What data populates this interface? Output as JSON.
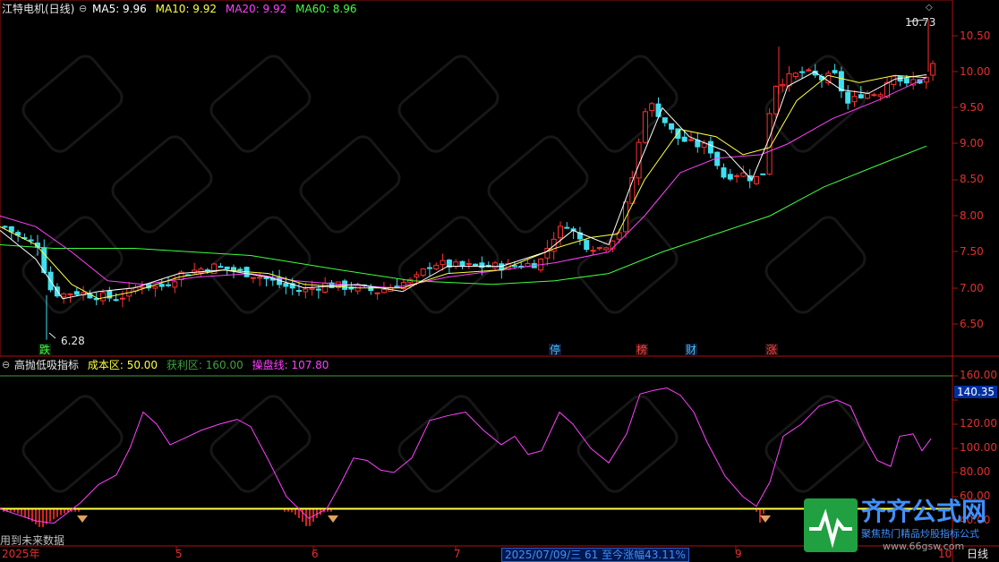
{
  "main": {
    "title": "江特电机(日线)",
    "ma_labels": [
      {
        "text": "MA5: 9.96",
        "color": "#ffffff"
      },
      {
        "text": "MA10: 9.92",
        "color": "#ffff40"
      },
      {
        "text": "MA20: 9.92",
        "color": "#ff40ff"
      },
      {
        "text": "MA60: 8.96",
        "color": "#40ff40"
      }
    ],
    "price_axis": [
      "10.50",
      "10.00",
      "9.50",
      "9.00",
      "8.50",
      "8.00",
      "7.50",
      "7.00",
      "6.50"
    ],
    "high_label": "10.73",
    "low_label": "6.28",
    "event_tags": [
      {
        "text": "跌",
        "color": "#40ff40"
      },
      {
        "text": "停",
        "color": "#40c0ff"
      },
      {
        "text": "榜",
        "color": "#ff4040"
      },
      {
        "text": "财",
        "color": "#40c0ff"
      },
      {
        "text": "涨",
        "color": "#ff4040"
      }
    ]
  },
  "indicator": {
    "name": "高抛低吸指标",
    "cost_zone": "成本区: 50.00",
    "profit_zone": "获利区: 160.00",
    "operate_line": "操盘线: 107.80",
    "axis": [
      "160.00",
      "140.00",
      "120.00",
      "100.00",
      "80.00",
      "60.00",
      "40.00"
    ],
    "current_value": "140.35",
    "note": "用到未来数据"
  },
  "time_axis": {
    "labels": [
      "2025年",
      "5",
      "6",
      "7",
      "9",
      "10"
    ],
    "info": "2025/07/09/三 61 至今涨幅43.11%",
    "period": "日线"
  },
  "watermark": {
    "brand": "齐齐公式网",
    "slogan": "聚焦热门精品炒股指标公式",
    "url": "www.66gsw.com"
  },
  "colors": {
    "up": "#ff3030",
    "down": "#40e0f0",
    "ma5": "#ffffff",
    "ma10": "#ffff40",
    "ma20": "#ff40ff",
    "ma60": "#40ff40",
    "indicator_line": "#ff40ff",
    "cost_line": "#ffff40",
    "profit_line": "#40a040"
  }
}
